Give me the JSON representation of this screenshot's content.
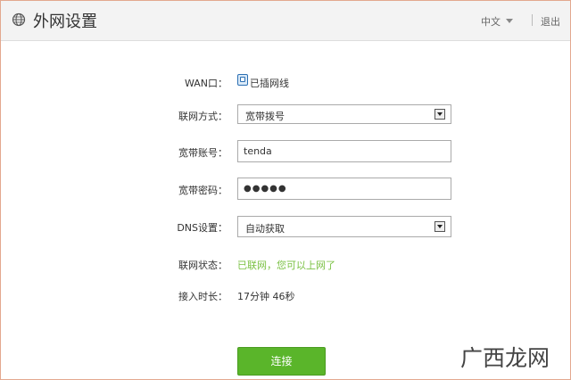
{
  "header": {
    "title": "外网设置",
    "language": "中文",
    "logout_label": "退出"
  },
  "form": {
    "wan_label": "WAN口：",
    "wan_status": "已插网线",
    "connection_type_label": "联网方式：",
    "connection_type_value": "宽带拨号",
    "account_label": "宽带账号：",
    "account_value": "tenda",
    "password_label": "宽带密码：",
    "password_value": "●●●●●",
    "dns_label": "DNS设置：",
    "dns_value": "自动获取",
    "status_label": "联网状态：",
    "status_value": "已联网，您可以上网了",
    "duration_label": "接入时长：",
    "duration_value": "17分钟 46秒",
    "connect_label": "连接"
  },
  "watermark": "广西龙网",
  "colors": {
    "accent_green": "#5ab52a",
    "status_green": "#7ac143",
    "frame_border": "#e3a88f",
    "header_bg": "#f3f3f3"
  }
}
